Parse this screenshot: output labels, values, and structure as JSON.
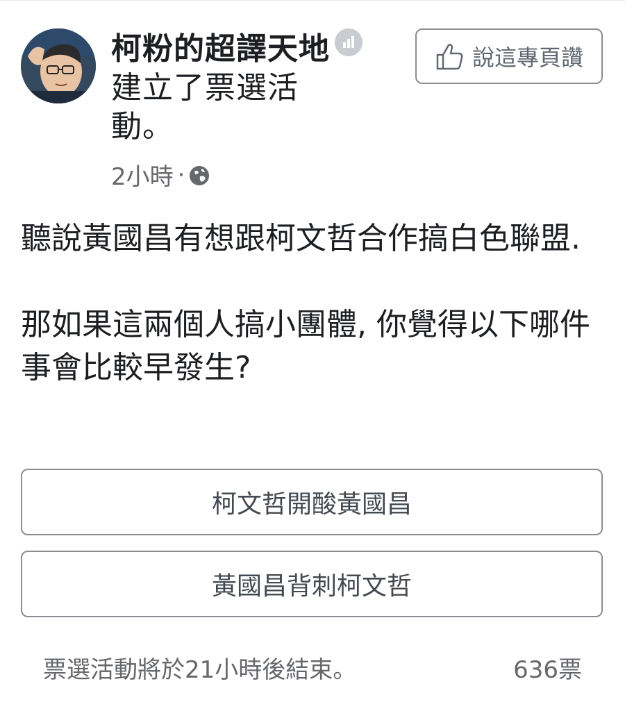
{
  "post": {
    "author_name": "柯粉的超譯天地",
    "action_text": "建立了票選活動。",
    "time": "2小時",
    "separator": "·",
    "privacy_icon": "globe-icon",
    "like_page_label": "說這專頁讚",
    "body_lines": [
      "聽說黃國昌有想跟柯文哲合作搞白色聯盟.",
      "那如果這兩個人搞小團體, 你覺得以下哪件事會比較早發生?"
    ]
  },
  "poll": {
    "options": [
      "柯文哲開酸黃國昌",
      "黃國昌背刺柯文哲"
    ],
    "status_text": "票選活動將於21小時後結束。",
    "votes_text": "636票"
  },
  "colors": {
    "text_primary": "#1c1e21",
    "text_secondary": "#65676b",
    "border": "#8a8d91"
  }
}
